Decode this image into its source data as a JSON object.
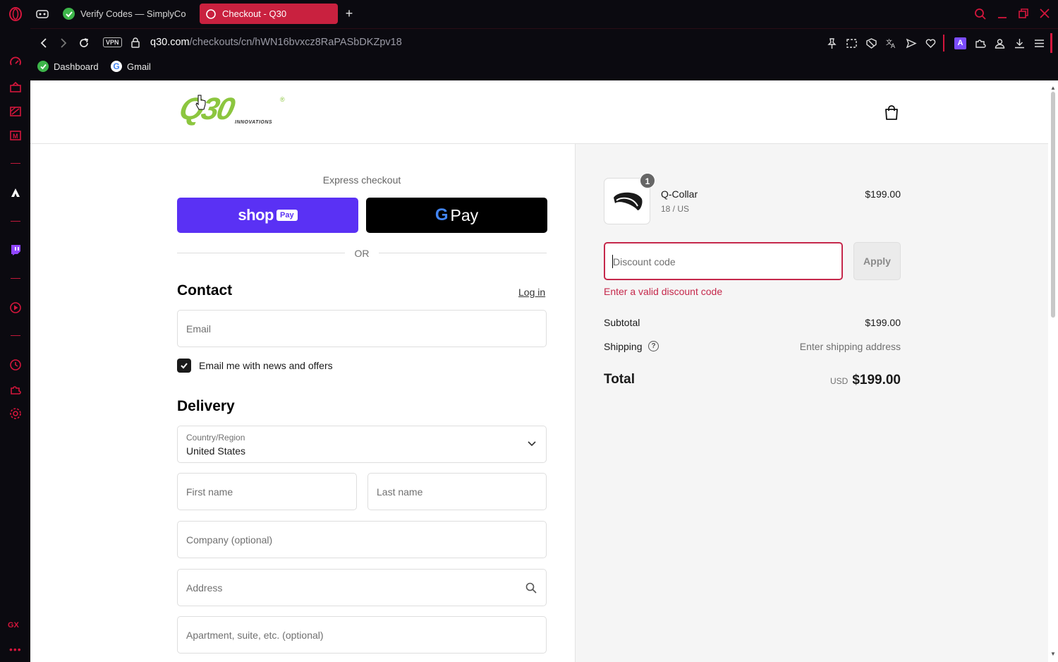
{
  "browser": {
    "tabs": [
      {
        "title": "Verify Codes — SimplyCo",
        "active": false
      },
      {
        "title": "Checkout - Q30",
        "active": true
      }
    ],
    "new_tab_label": "+",
    "vpn_label": "VPN",
    "url_host": "q30.com",
    "url_path": "/checkouts/cn/hWN16bvxcz8RaPASbDKZpv18",
    "bookmarks": [
      {
        "label": "Dashboard"
      },
      {
        "label": "Gmail"
      }
    ],
    "sidebar_bottom_label": "GX",
    "colors": {
      "accent": "#d4163c",
      "tab_active": "#c9213f",
      "chrome_bg": "#0b0a10"
    }
  },
  "store": {
    "logo_text": "Q30",
    "logo_sub": "INNOVATIONS",
    "logo_mark": "®",
    "brand_color": "#8cc63f"
  },
  "checkout": {
    "express_label": "Express checkout",
    "shop_pay_label": "shop",
    "shop_pay_badge": "Pay",
    "gpay_label": "Pay",
    "or_label": "OR",
    "contact_heading": "Contact",
    "login_link": "Log in",
    "email_placeholder": "Email",
    "newsletter_label": "Email me with news and offers",
    "newsletter_checked": true,
    "delivery_heading": "Delivery",
    "country_label": "Country/Region",
    "country_value": "United States",
    "first_name_placeholder": "First name",
    "last_name_placeholder": "Last name",
    "company_placeholder": "Company (optional)",
    "address_placeholder": "Address",
    "apartment_placeholder": "Apartment, suite, etc. (optional)"
  },
  "summary": {
    "item": {
      "name": "Q-Collar",
      "variant": "18 / US",
      "price": "$199.00",
      "quantity": "1"
    },
    "discount_placeholder": "Discount code",
    "apply_label": "Apply",
    "discount_error": "Enter a valid discount code",
    "subtotal_label": "Subtotal",
    "subtotal_value": "$199.00",
    "shipping_label": "Shipping",
    "shipping_value": "Enter shipping address",
    "total_label": "Total",
    "currency": "USD",
    "total_value": "$199.00",
    "error_color": "#c5284b",
    "shop_pay_color": "#5a31f4"
  }
}
